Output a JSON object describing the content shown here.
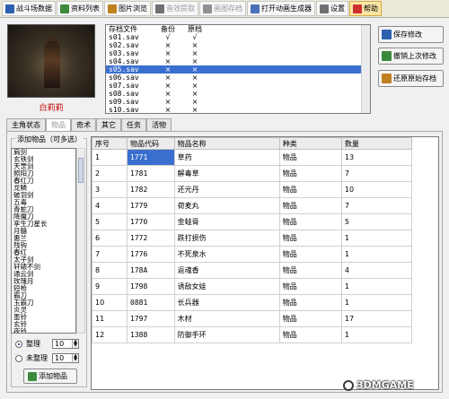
{
  "toolbar": {
    "buttons": [
      {
        "label": "战斗场数据",
        "icon": "save-icon",
        "color": "#2d5fb0",
        "disabled": false,
        "active": false
      },
      {
        "label": "资料列表",
        "icon": "list-icon",
        "color": "#3c8a3c",
        "disabled": false,
        "active": false
      },
      {
        "label": "图片浏览",
        "icon": "image-icon",
        "color": "#c08020",
        "disabled": false,
        "active": false
      },
      {
        "label": "音效提取",
        "icon": "speaker-icon",
        "color": "#707070",
        "disabled": true,
        "active": false
      },
      {
        "label": "画图存档",
        "icon": "paint-icon",
        "color": "#909090",
        "disabled": true,
        "active": false
      },
      {
        "label": "打开动画生成器",
        "icon": "monitor-icon",
        "color": "#4a70b8",
        "disabled": false,
        "active": false
      },
      {
        "label": "设置",
        "icon": "gear-icon",
        "color": "#707070",
        "disabled": false,
        "active": false
      },
      {
        "label": "帮助",
        "icon": "help-icon",
        "color": "#d03030",
        "disabled": false,
        "active": true
      }
    ]
  },
  "character": {
    "name": "白莉莉"
  },
  "save_list": {
    "headers": [
      "存档文件",
      "备份",
      "原档"
    ],
    "rows": [
      {
        "file": "s01.sav",
        "backup": "√",
        "original": "√",
        "selected": false
      },
      {
        "file": "s02.sav",
        "backup": "×",
        "original": "×",
        "selected": false
      },
      {
        "file": "s03.sav",
        "backup": "×",
        "original": "×",
        "selected": false
      },
      {
        "file": "s04.sav",
        "backup": "×",
        "original": "×",
        "selected": false
      },
      {
        "file": "s05.sav",
        "backup": "×",
        "original": "×",
        "selected": true
      },
      {
        "file": "s06.sav",
        "backup": "×",
        "original": "×",
        "selected": false
      },
      {
        "file": "s07.sav",
        "backup": "×",
        "original": "×",
        "selected": false
      },
      {
        "file": "s08.sav",
        "backup": "×",
        "original": "×",
        "selected": false
      },
      {
        "file": "s09.sav",
        "backup": "×",
        "original": "×",
        "selected": false
      },
      {
        "file": "s10.sav",
        "backup": "×",
        "original": "×",
        "selected": false
      }
    ]
  },
  "right_buttons": [
    {
      "label": "保存修改",
      "icon": "disk-icon",
      "color": "#2d5fb0"
    },
    {
      "label": "撤销上次修改",
      "icon": "undo-icon",
      "color": "#3c8a3c"
    },
    {
      "label": "还原原始存档",
      "icon": "restore-icon",
      "color": "#c08020"
    }
  ],
  "tabs": [
    {
      "label": "主角状态",
      "active": false,
      "dim": false
    },
    {
      "label": "物品",
      "active": true,
      "dim": true
    },
    {
      "label": "奇术",
      "active": false,
      "dim": false
    },
    {
      "label": "其它",
      "active": false,
      "dim": false
    },
    {
      "label": "任务",
      "active": false,
      "dim": false
    },
    {
      "label": "活物",
      "active": false,
      "dim": false
    }
  ],
  "add_panel": {
    "title": "添加物品（可多选）",
    "items": [
      "肩剑",
      "玄铁剑",
      "天罡剑",
      "照阳刀",
      "春红刀",
      "龙鳞",
      "破羽剑",
      "五毒",
      "青蛇刀",
      "降魔刀",
      "孪生刀星长",
      "月髓",
      "惠兰",
      "残钩",
      "春红",
      "太子剑",
      "轩辕不剑",
      "通云剑",
      "玫瑰月",
      "短枪",
      "霸刀",
      "玉霸刀",
      "炎灵",
      "墨铃",
      "玄铃",
      "夜铃"
    ],
    "radio1_label": "整理",
    "radio1_value": "10",
    "radio2_label": "未整理",
    "radio2_value": "10",
    "add_button": "添加物品"
  },
  "item_table": {
    "headers": [
      "序号",
      "物品代码",
      "物品名称",
      "种类",
      "数量"
    ],
    "rows": [
      {
        "idx": "1",
        "code": "1771",
        "name": "草药",
        "kind": "物品",
        "qty": "13"
      },
      {
        "idx": "2",
        "code": "1781",
        "name": "解毒草",
        "kind": "物品",
        "qty": "7"
      },
      {
        "idx": "3",
        "code": "1782",
        "name": "还元丹",
        "kind": "物品",
        "qty": "10"
      },
      {
        "idx": "4",
        "code": "1779",
        "name": "荷麦丸",
        "kind": "物品",
        "qty": "7"
      },
      {
        "idx": "5",
        "code": "1770",
        "name": "金蛙膏",
        "kind": "物品",
        "qty": "5"
      },
      {
        "idx": "6",
        "code": "1772",
        "name": "跌打损伤",
        "kind": "物品",
        "qty": "1"
      },
      {
        "idx": "7",
        "code": "1776",
        "name": "不死泉水",
        "kind": "物品",
        "qty": "1"
      },
      {
        "idx": "8",
        "code": "178A",
        "name": "返魂香",
        "kind": "物品",
        "qty": "4"
      },
      {
        "idx": "9",
        "code": "1798",
        "name": "诱敌女娃",
        "kind": "物品",
        "qty": "1"
      },
      {
        "idx": "10",
        "code": "0881",
        "name": "长兵器",
        "kind": "物品",
        "qty": "1"
      },
      {
        "idx": "11",
        "code": "1797",
        "name": "木材",
        "kind": "物品",
        "qty": "17"
      },
      {
        "idx": "12",
        "code": "1388",
        "name": "防御手环",
        "kind": "物品",
        "qty": "1"
      }
    ]
  },
  "watermark": {
    "text": "3DMGAME"
  }
}
